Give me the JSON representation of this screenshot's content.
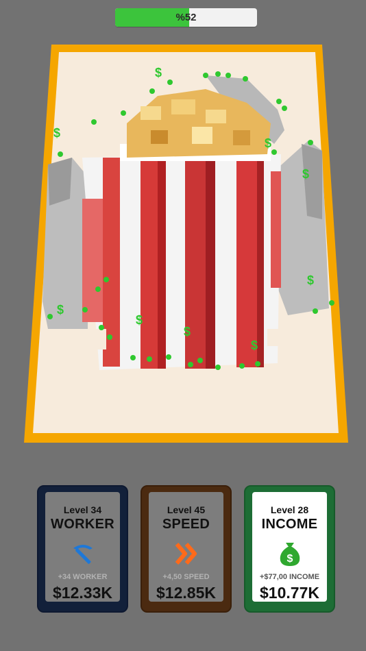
{
  "progress": {
    "percent": 52,
    "label": "%52",
    "fill_color": "#3cc43c"
  },
  "board": {
    "frame_color": "#f5a600",
    "floor_color": "#f7ebdc",
    "art": "popcorn-bucket"
  },
  "upgrades": [
    {
      "level": "Level 34",
      "title": "WORKER",
      "icon": "pickaxe-icon",
      "bonus": "+34 WORKER",
      "price": "$12.33K",
      "icon_color": "#1e78d8",
      "card_color": "#12203a"
    },
    {
      "level": "Level 45",
      "title": "SPEED",
      "icon": "fast-forward-icon",
      "bonus": "+4,50 SPEED",
      "price": "$12.85K",
      "icon_color": "#ff6a1a",
      "card_color": "#4b2a10"
    },
    {
      "level": "Level 28",
      "title": "INCOME",
      "icon": "money-bag-icon",
      "bonus": "+$77,00 INCOME",
      "price": "$10.77K",
      "icon_color": "#2fa82f",
      "card_color": "#1d6d35"
    }
  ]
}
